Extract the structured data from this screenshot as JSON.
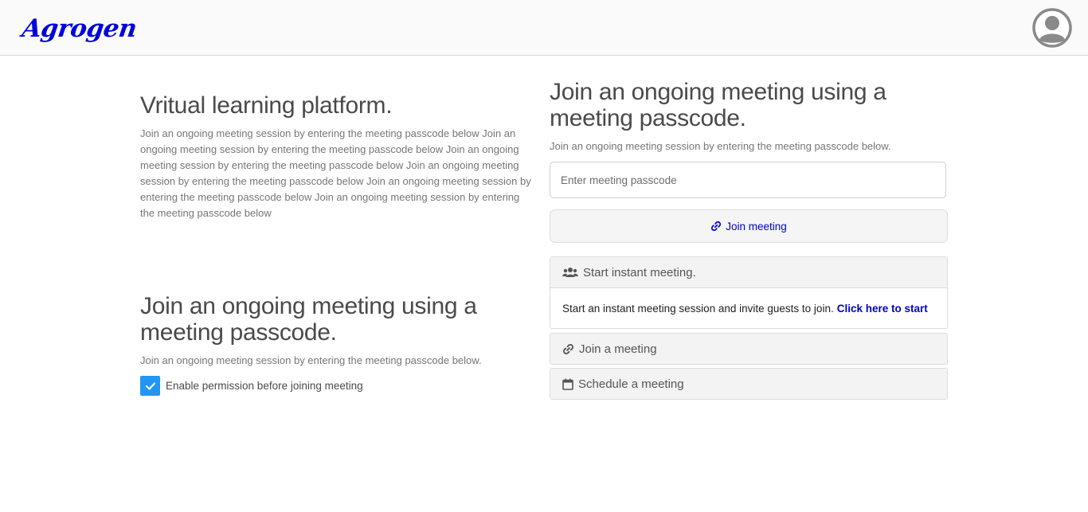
{
  "brand": {
    "name": "Agrogen",
    "color": "#0000dd"
  },
  "header": {
    "avatar_icon": "user-circle-icon"
  },
  "left": {
    "title": "Vritual learning platform.",
    "description": "Join an ongoing meeting session by entering the meeting passcode below Join an ongoing meeting session by entering the meeting passcode below Join an ongoing meeting session by entering the meeting passcode below Join an ongoing meeting session by entering the meeting passcode below Join an ongoing meeting session by entering the meeting passcode below Join an ongoing meeting session by entering the meeting passcode below",
    "section_title": "Join an ongoing meeting using a meeting passcode.",
    "section_desc": "Join an ongoing meeting session by entering the meeting passcode below.",
    "permission_label": "Enable permission before joining meeting",
    "permission_checked": true
  },
  "right": {
    "title": "Join an ongoing meeting using a meeting passcode.",
    "description": "Join an ongoing meeting session by entering the meeting passcode below.",
    "passcode_placeholder": "Enter meeting passcode",
    "passcode_value": "",
    "join_button": "Join meeting",
    "cards": [
      {
        "title": "Start instant meeting.",
        "icon": "users-icon",
        "body_text": "Start an instant meeting session and invite guests to join.",
        "body_link": "Click here to start"
      },
      {
        "title": "Join a meeting",
        "icon": "link-icon"
      },
      {
        "title": "Schedule a meeting",
        "icon": "calendar-icon"
      }
    ]
  },
  "colors": {
    "accent_link": "#0000cc",
    "checkbox": "#2196f3"
  }
}
